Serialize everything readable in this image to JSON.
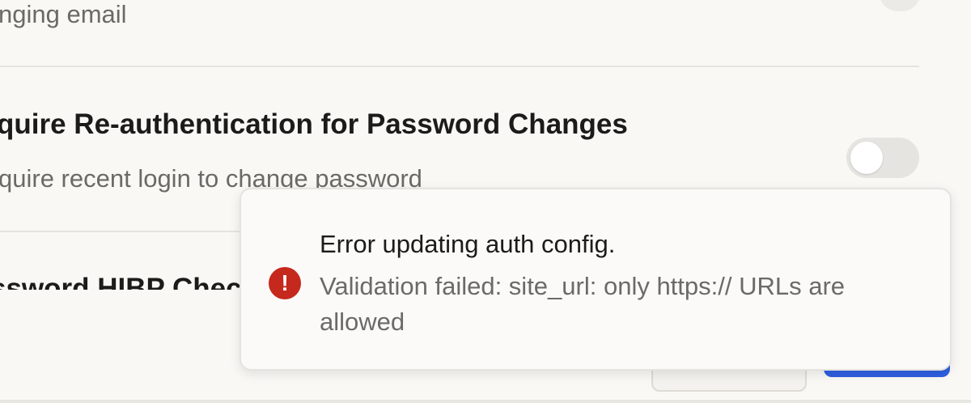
{
  "settings": {
    "prev_desc": "nging email",
    "reauth": {
      "title": "quire Re-authentication for Password Changes",
      "description": "quire recent login to change password",
      "enabled": false
    },
    "next_title_partial": "ssword HIBP Chec"
  },
  "toast": {
    "type": "error",
    "icon": "error-icon",
    "title": "Error updating auth config.",
    "message": "Validation failed: site_url: only https:// URLs are allowed"
  },
  "colors": {
    "error": "#c5281c",
    "primary": "#2f5fe0",
    "background": "#f9f8f5"
  }
}
